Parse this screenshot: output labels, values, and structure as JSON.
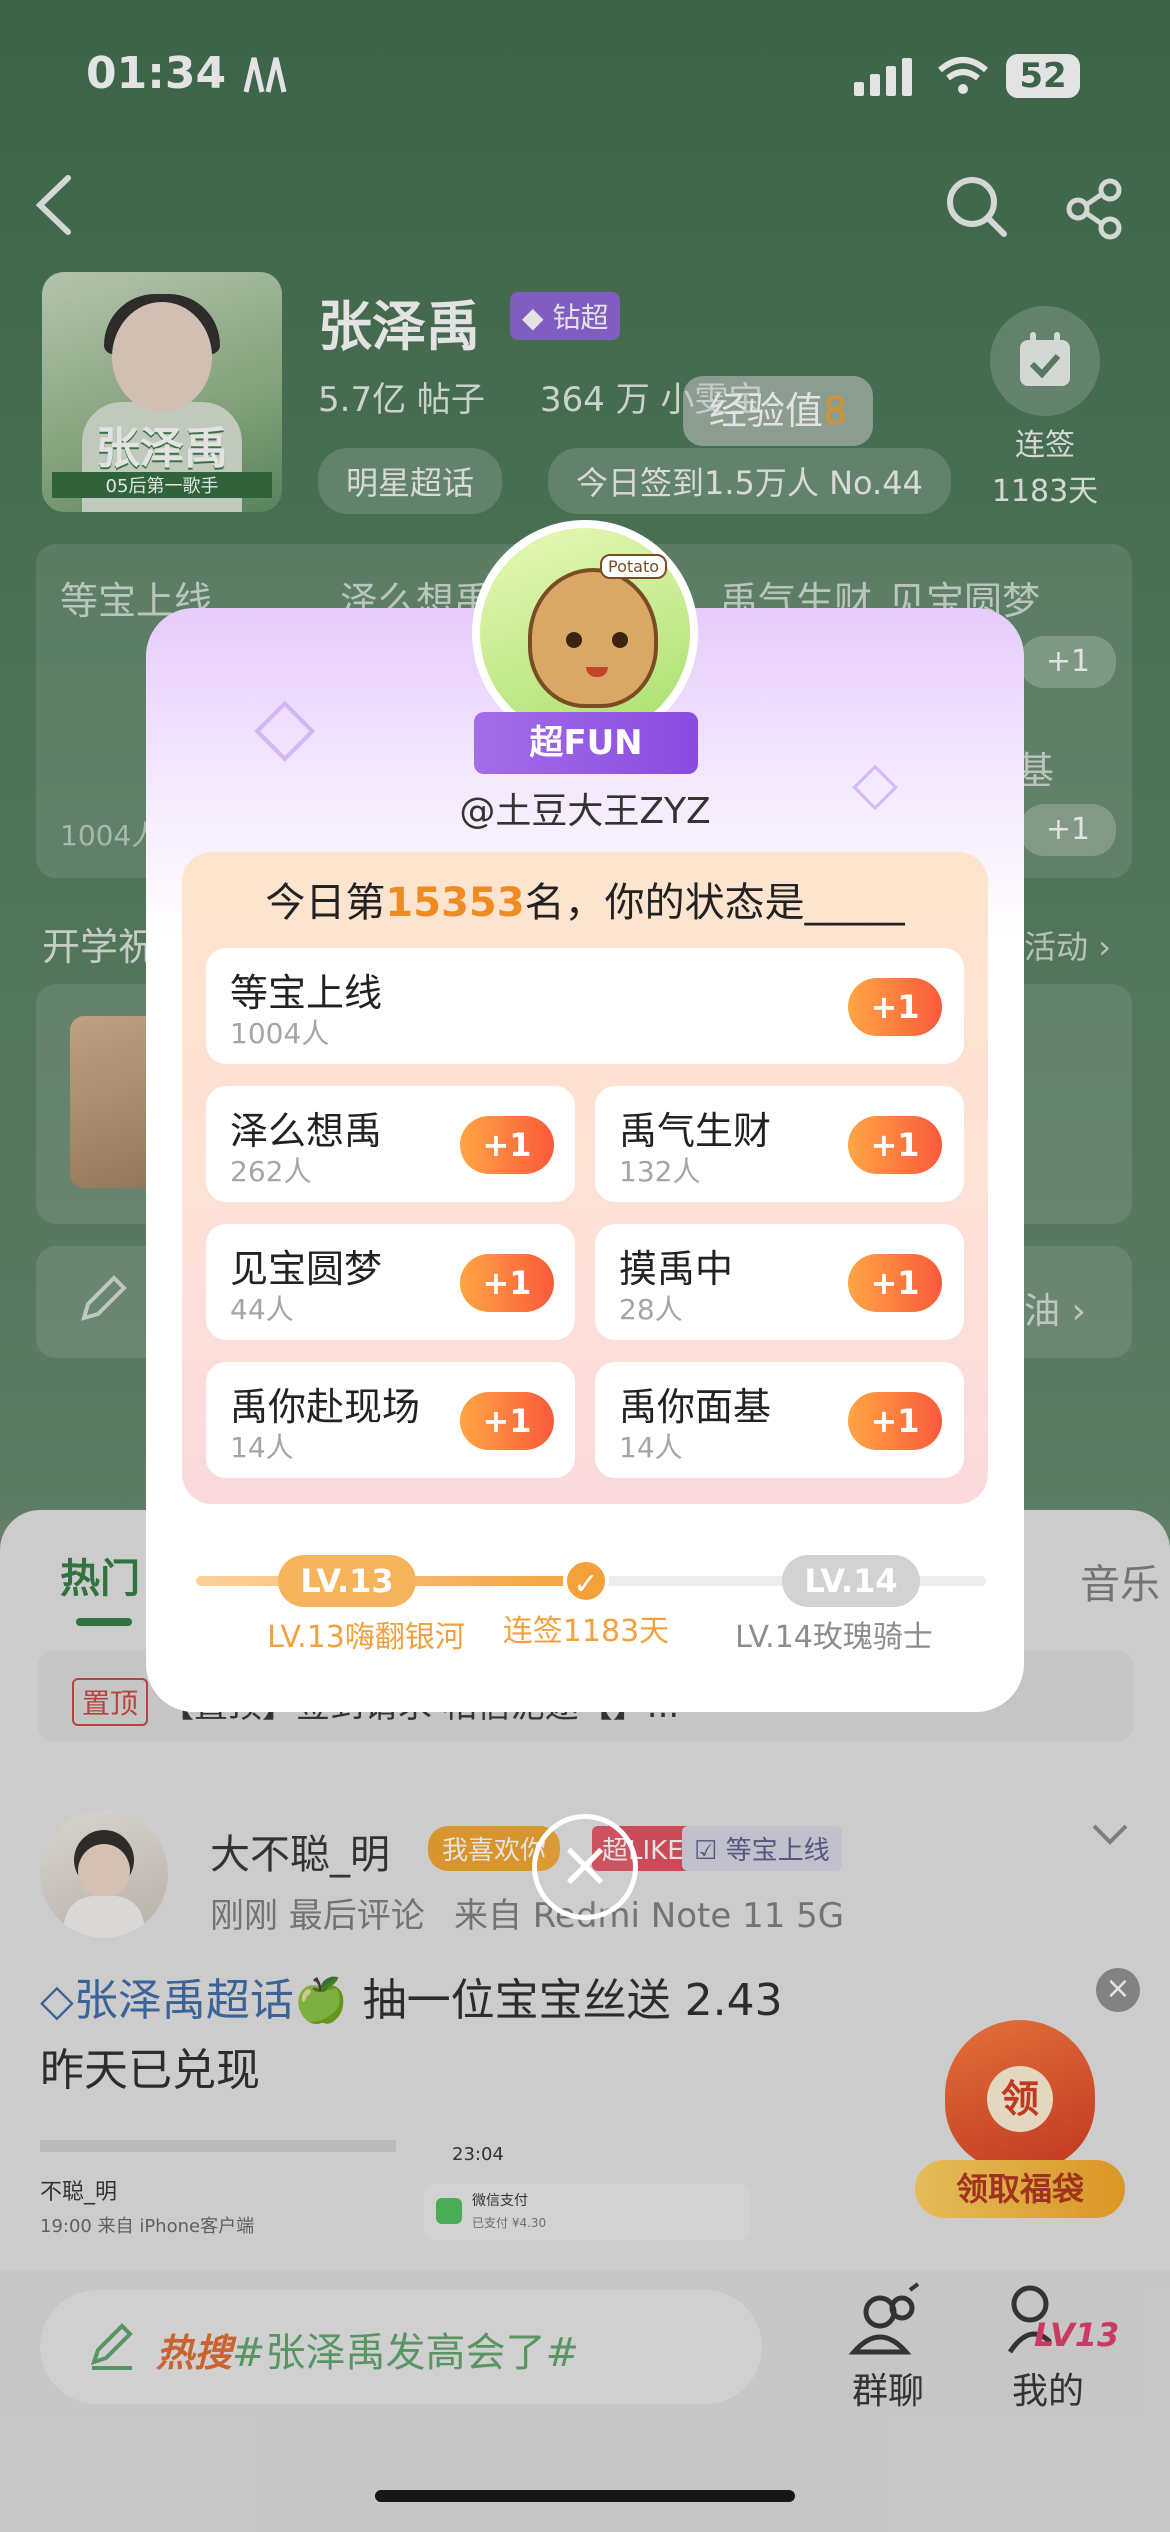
{
  "status_bar": {
    "time": "01:34",
    "battery": "52"
  },
  "header": {
    "back": "back-icon",
    "search": "search-icon",
    "share": "share-icon"
  },
  "topic": {
    "title": "张泽禹",
    "badge": "钻超",
    "posts": "5.7亿 帖子",
    "members": "364 万 小雯宝",
    "tag_pill": "明星超话",
    "checkin_pill": "今日签到1.5万人 No.44",
    "checkin_label": "连签",
    "checkin_days": "1183天",
    "exp_label": "经验值",
    "exp_value": "8",
    "avatar_caption": "张泽禹",
    "avatar_sub": "05后第一歌手"
  },
  "background": {
    "status_cards": [
      "等宝上线",
      "泽么想禹",
      "禹气生财",
      "见宝圆梦"
    ],
    "card_side": "基",
    "card_count": "1004人",
    "section": "开学祝",
    "section_right": "活动",
    "row_right": "油",
    "tabs": {
      "hot": "热门",
      "music": "音乐"
    },
    "pinned_tag": "置顶",
    "pinned_text": "【置顶】签到请求·相信泥途【】..."
  },
  "post": {
    "name": "大不聪_明",
    "badge1": "我喜欢你",
    "badge2": "超LIKE",
    "badge3": "等宝上线",
    "meta_time": "刚刚 最后评论",
    "meta_source": "来自 Redmi Note 11 5G",
    "topic_link": "张泽禹超话",
    "text_line1": " 抽一位宝宝丝送 2.43",
    "text_line2": "昨天已兑现",
    "emoji": "🍏",
    "preview_name": "不聪_明",
    "preview_line": "19:00  来自 iPhone客户端",
    "preview_time": "23:04",
    "preview_pay": "微信支付",
    "preview_paid": "已支付 ¥4.30"
  },
  "fu_bag": {
    "label": "领取福袋",
    "char": "领"
  },
  "bottom": {
    "compose_hot": "热搜",
    "compose_text": "#张泽禹发高会了#",
    "nav": [
      {
        "label": "群聊",
        "icon": "group-chat-icon"
      },
      {
        "label": "我的",
        "icon": "profile-icon",
        "level": "LV13"
      }
    ]
  },
  "modal": {
    "fan_badge": "超FUN",
    "avatar_tag": "Potato",
    "username": "@土豆大王ZYZ",
    "rank_prefix": "今日第",
    "rank_number": "15353",
    "rank_suffix": "名，你的状态是_____",
    "plus_label": "+1",
    "statuses": [
      {
        "name": "等宝上线",
        "count": "1004人"
      },
      {
        "name": "泽么想禹",
        "count": "262人"
      },
      {
        "name": "禹气生财",
        "count": "132人"
      },
      {
        "name": "见宝圆梦",
        "count": "44人"
      },
      {
        "name": "摸禹中",
        "count": "28人"
      },
      {
        "name": "禹你赴现场",
        "count": "14人"
      },
      {
        "name": "禹你面基",
        "count": "14人"
      }
    ],
    "level": {
      "current": "LV.13",
      "current_name": "LV.13嗨翻银河",
      "streak": "连签1183天",
      "next": "LV.14",
      "next_name": "LV.14玫瑰骑士",
      "progress": 0.5
    }
  },
  "colors": {
    "brand_green": "#3d6b4b",
    "accent_orange": "#f5a13b",
    "plus_gradient_end": "#fa5a3a"
  }
}
